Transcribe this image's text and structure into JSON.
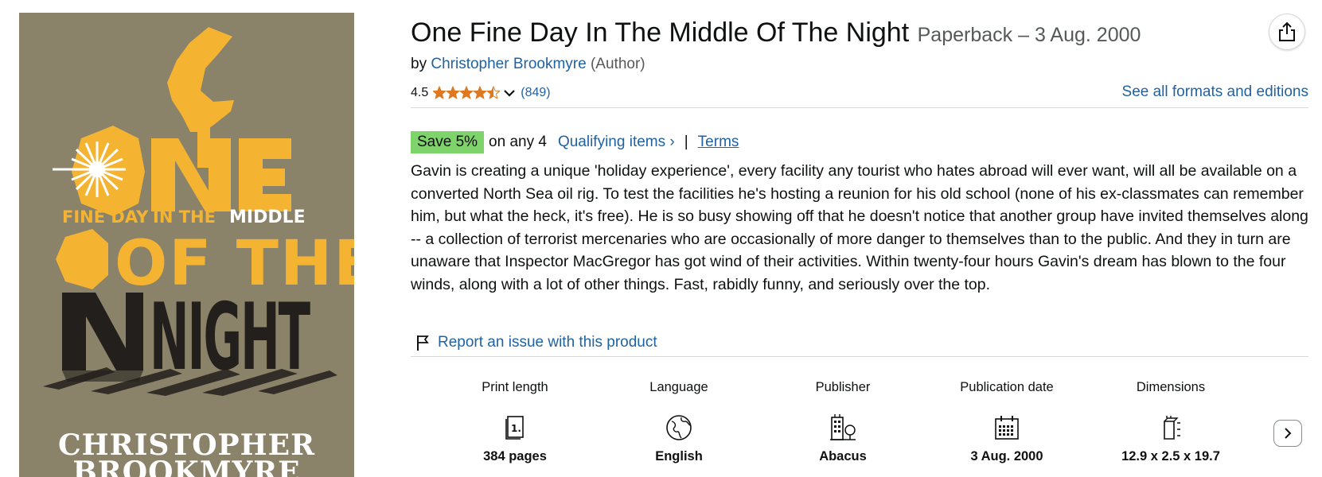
{
  "cover": {
    "art_lines": [
      "FINE DAY",
      "IN THE",
      "MIDDLE",
      "OF THE",
      "NIGHT"
    ],
    "author_lines": [
      "CHRISTOPHER",
      "BROOKMYRE"
    ],
    "colors": {
      "background": "#8b826a",
      "yellow": "#f4b432",
      "dark": "#231f1c",
      "white": "#ffffff"
    }
  },
  "product": {
    "title": "One Fine Day In The Middle Of The Night",
    "format": "Paperback – 3 Aug. 2000",
    "by_label": "by",
    "author": "Christopher Brookmyre",
    "author_role": "(Author)",
    "rating": "4.5",
    "stars_filled": 4.5,
    "rating_count": "(849)",
    "formats_link": "See all formats and editions"
  },
  "promo": {
    "badge": "Save 5%",
    "text": "on any 4",
    "qualifying": "Qualifying items ›",
    "separator": "|",
    "terms": "Terms"
  },
  "description": "Gavin is creating a unique 'holiday experience', every facility any tourist who hates abroad will ever want, will all be available on a converted North Sea oil rig. To test the facilities he's hosting a reunion for his old school (none of his ex-classmates can remember him, but what the heck, it's free). He is so busy showing off that he doesn't notice that another group have invited themselves along -- a collection of terrorist mercenaries who are occasionally of more danger to themselves than to the public. And they in turn are unaware that Inspector MacGregor has got wind of their activities. Within twenty-four hours Gavin's dream has blown to the four winds, along with a lot of other things. Fast, rabidly funny, and seriously over the top.",
  "report_link": "Report an issue with this product",
  "specs": [
    {
      "label": "Print length",
      "value": "384 pages",
      "icon": "book-pages-icon"
    },
    {
      "label": "Language",
      "value": "English",
      "icon": "globe-icon"
    },
    {
      "label": "Publisher",
      "value": "Abacus",
      "icon": "building-icon"
    },
    {
      "label": "Publication date",
      "value": "3 Aug. 2000",
      "icon": "calendar-icon"
    },
    {
      "label": "Dimensions",
      "value": "12.9 x 2.5 x 19.7",
      "icon": "dimensions-icon"
    }
  ],
  "colors": {
    "link": "#2162a1",
    "star": "#de7921",
    "save_badge": "#7fd36b",
    "muted": "#565959"
  }
}
